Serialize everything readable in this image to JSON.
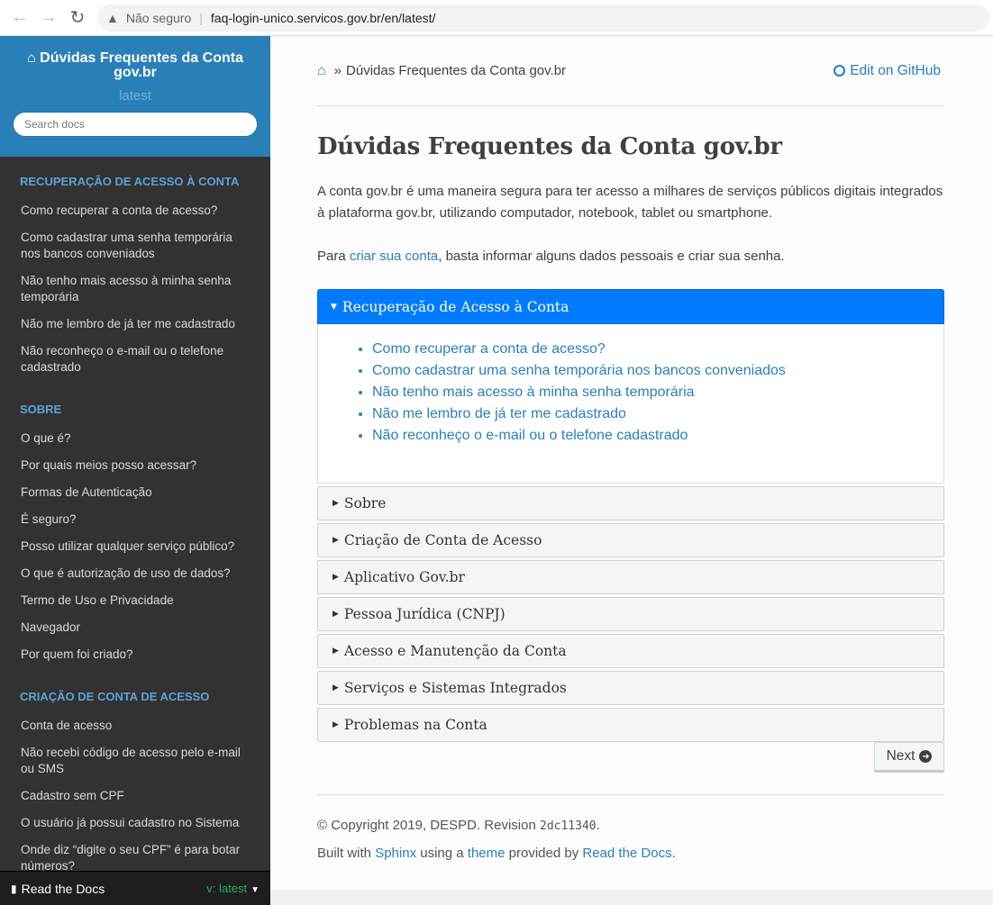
{
  "browser": {
    "insecure_label": "Não seguro",
    "url": "faq-login-unico.servicos.gov.br/en/latest/"
  },
  "sidebar": {
    "title": "Dúvidas Frequentes da Conta gov.br",
    "version": "latest",
    "search_placeholder": "Search docs",
    "sections": [
      {
        "caption": "RECUPERAÇÃO DE ACESSO À CONTA",
        "items": [
          "Como recuperar a conta de acesso?",
          "Como cadastrar uma senha temporária nos bancos conveniados",
          "Não tenho mais acesso à minha senha temporária",
          "Não me lembro de já ter me cadastrado",
          "Não reconheço o e-mail ou o telefone cadastrado"
        ]
      },
      {
        "caption": "SOBRE",
        "items": [
          "O que é?",
          "Por quais meios posso acessar?",
          "Formas de Autenticação",
          "É seguro?",
          "Posso utilizar qualquer serviço público?",
          "O que é autorização de uso de dados?",
          "Termo de Uso e Privacidade",
          "Navegador",
          "Por quem foi criado?"
        ]
      },
      {
        "caption": "CRIAÇÃO DE CONTA DE ACESSO",
        "items": [
          "Conta de acesso",
          "Não recebi código de acesso pelo e-mail ou SMS",
          "Cadastro sem CPF",
          "O usuário já possui cadastro no Sistema",
          "Onde diz “digite o seu CPF” é para botar números?"
        ]
      }
    ],
    "footer": {
      "rtd_label": "Read the Docs",
      "version_label": "v: latest"
    }
  },
  "breadcrumb": {
    "separator": "»",
    "current": "Dúvidas Frequentes da Conta gov.br",
    "edit_label": "Edit on GitHub"
  },
  "main": {
    "title": "Dúvidas Frequentes da Conta gov.br",
    "intro": "A conta gov.br é uma maneira segura para ter acesso a milhares de serviços públicos digitais integrados à plataforma gov.br, utilizando computador, notebook, tablet ou smartphone.",
    "intro2_before": "Para ",
    "intro2_link": "criar sua conta",
    "intro2_after": ", basta informar alguns dados pessoais e criar sua senha.",
    "open_section": {
      "title": "Recuperação de Acesso à Conta",
      "links": [
        "Como recuperar a conta de acesso?",
        "Como cadastrar uma senha temporária nos bancos conveniados",
        "Não tenho mais acesso à minha senha temporária",
        "Não me lembro de já ter me cadastrado",
        "Não reconheço o e-mail ou o telefone cadastrado"
      ]
    },
    "closed_sections": [
      "Sobre",
      "Criação de Conta de Acesso",
      "Aplicativo Gov.br",
      "Pessoa Jurídica (CNPJ)",
      "Acesso e Manutenção da Conta",
      "Serviços e Sistemas Integrados",
      "Problemas na Conta"
    ],
    "next_label": "Next"
  },
  "footer": {
    "copyright_text": "© Copyright 2019, DESPD. Revision ",
    "revision": "2dc11340",
    "copyright_end": ".",
    "built_with": "Built with ",
    "sphinx": "Sphinx",
    "using_a": " using a ",
    "theme": "theme",
    "provided_by": " provided by ",
    "rtd": "Read the Docs",
    "end": "."
  },
  "colors": {
    "sidebar_bg": "#343131",
    "sidebar_top": "#2980b9",
    "caption": "#55a5d9",
    "link": "#2980b9",
    "accordion_active": "#007bff"
  }
}
